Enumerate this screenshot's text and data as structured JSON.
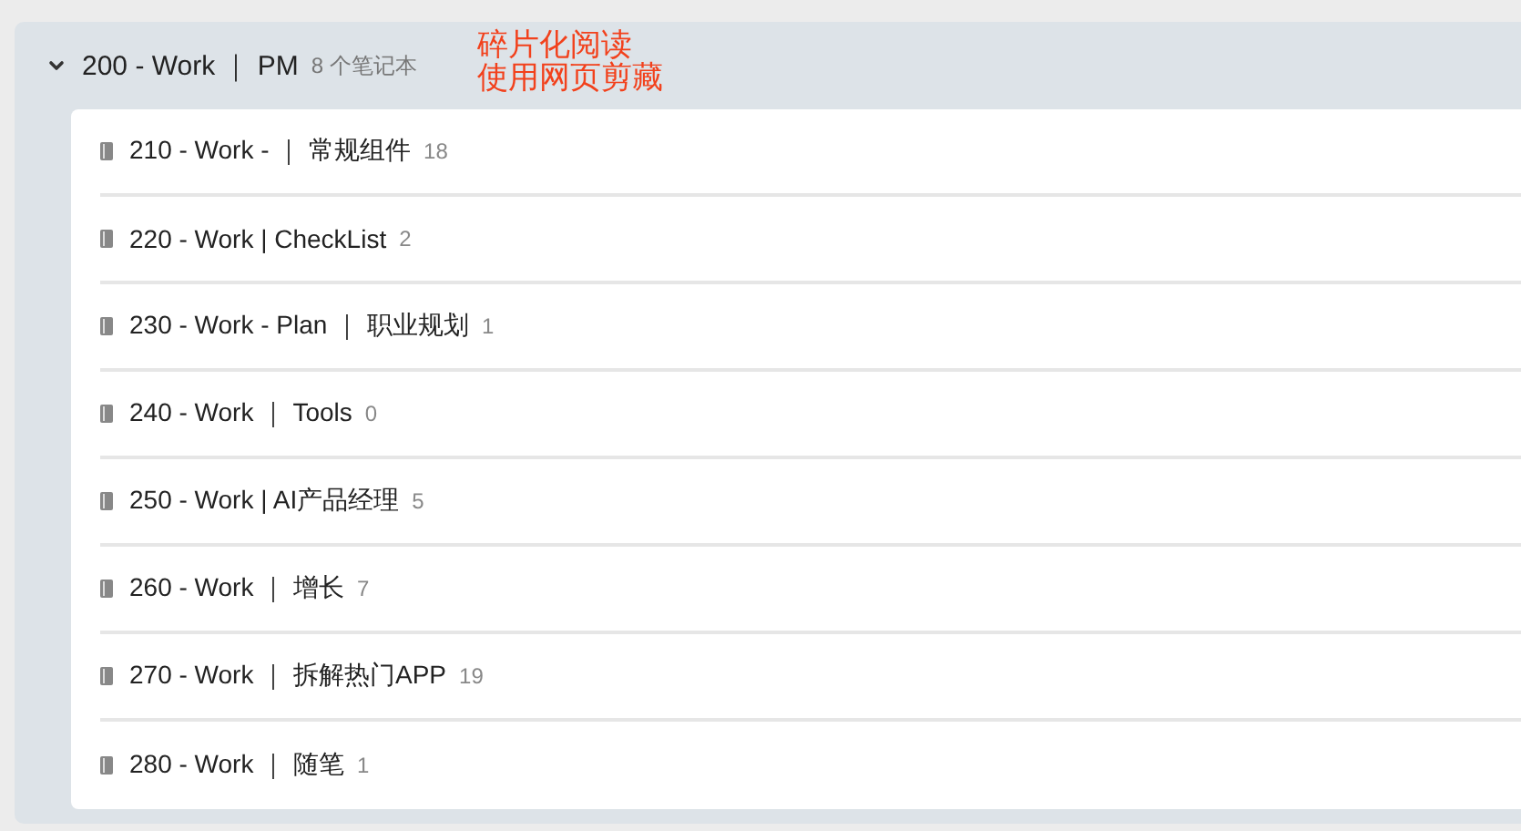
{
  "stack": {
    "title": "200 - Work ｜ PM",
    "count": "8 个笔记本",
    "expanded": true,
    "notebooks": [
      {
        "title": "210 - Work - ｜ 常规组件",
        "count": "18"
      },
      {
        "title": "220 - Work | CheckList",
        "count": "2"
      },
      {
        "title": "230 - Work - Plan ｜ 职业规划",
        "count": "1"
      },
      {
        "title": "240 - Work ｜ Tools",
        "count": "0"
      },
      {
        "title": "250 - Work | AI产品经理",
        "count": "5"
      },
      {
        "title": "260 - Work ｜ 增长",
        "count": "7"
      },
      {
        "title": "270 - Work ｜ 拆解热门APP",
        "count": "19"
      },
      {
        "title": "280 - Work ｜ 随笔",
        "count": "1"
      }
    ]
  },
  "annotation": {
    "lines": [
      "碎片化阅读",
      "使用网页剪藏"
    ]
  }
}
